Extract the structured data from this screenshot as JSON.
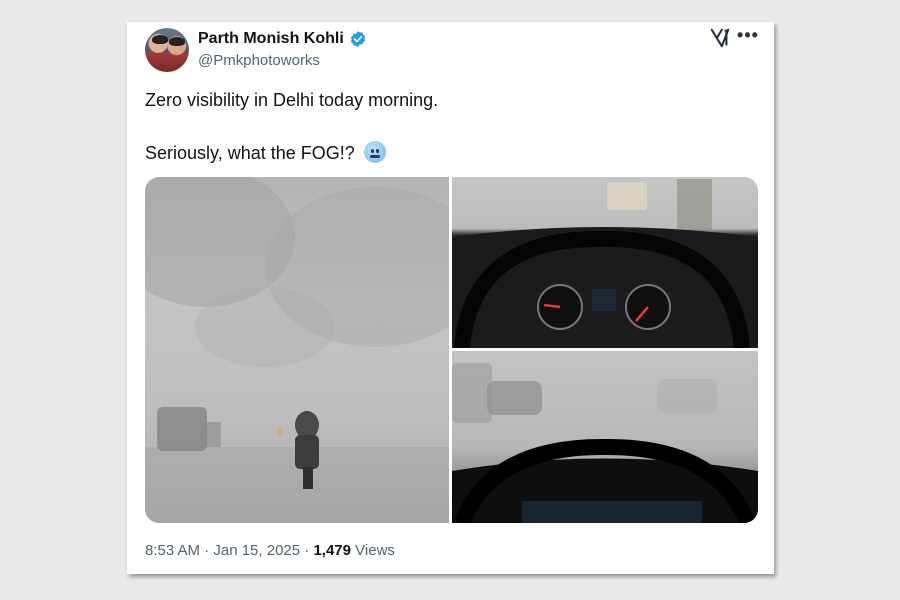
{
  "tweet": {
    "author_name": "Parth Monish Kohli",
    "handle": "@Pmkphotoworks",
    "text_line1": "Zero visibility in Delhi today morning.",
    "text_line2": "Seriously, what the FOG!?",
    "timestamp": "8:53 AM · Jan 15, 2025",
    "separator": " · ",
    "views_count": "1,479",
    "views_label": " Views"
  },
  "icons": {
    "verified": "verified-badge-icon",
    "brand": "x-logo-icon",
    "more": "more-options-icon",
    "emoji": "cold-face-emoji"
  },
  "colors": {
    "verified_blue": "#1d9bf0",
    "text_primary": "#0f1419",
    "text_secondary": "#536471"
  }
}
